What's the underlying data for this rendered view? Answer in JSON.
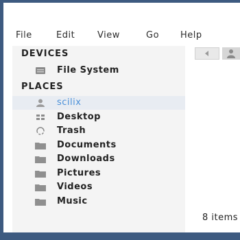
{
  "menu": [
    "File",
    "Edit",
    "View",
    "Go",
    "Help"
  ],
  "sidebar": {
    "devices_title": "DEVICES",
    "devices": [
      {
        "label": "File System",
        "icon": "drive-icon"
      }
    ],
    "places_title": "PLACES",
    "places": [
      {
        "label": "scilix",
        "icon": "user-home-icon",
        "selected": true
      },
      {
        "label": "Desktop",
        "icon": "desktop-icon"
      },
      {
        "label": "Trash",
        "icon": "trash-icon"
      },
      {
        "label": "Documents",
        "icon": "folder-icon"
      },
      {
        "label": "Downloads",
        "icon": "folder-icon"
      },
      {
        "label": "Pictures",
        "icon": "folder-icon"
      },
      {
        "label": "Videos",
        "icon": "folder-icon"
      },
      {
        "label": "Music",
        "icon": "folder-icon"
      }
    ]
  },
  "main": {
    "status_text": "8 items"
  },
  "colors": {
    "background": "#3d5a80",
    "selected_text": "#4a90d9",
    "sidebar_bg": "#f4f4f4"
  }
}
